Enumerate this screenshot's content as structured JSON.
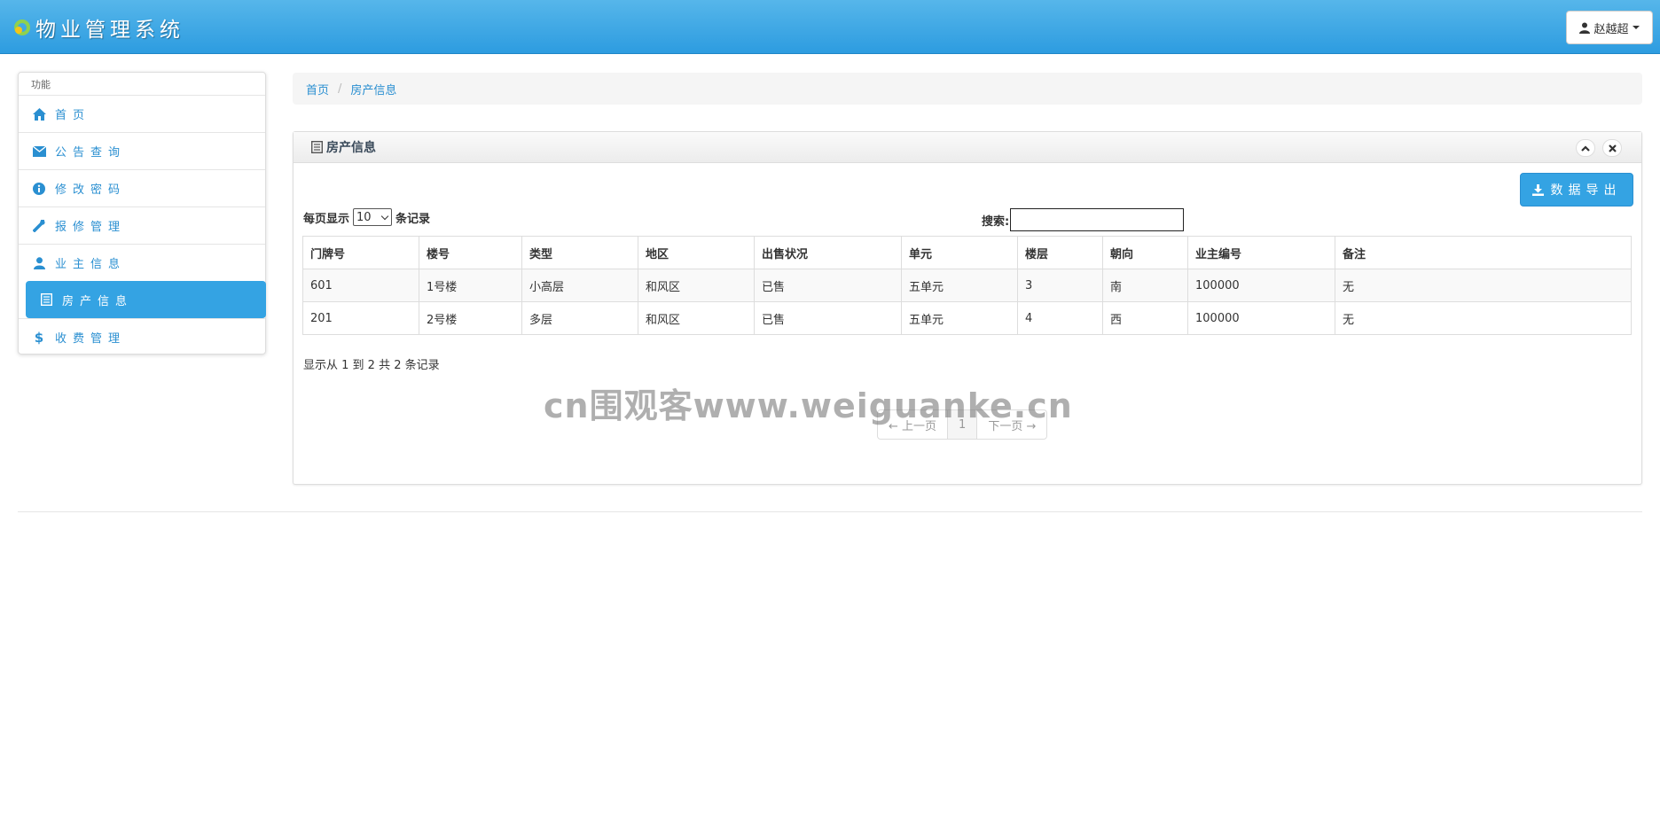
{
  "app": {
    "title": "物业管理系统",
    "user_name": "赵越超"
  },
  "sidebar": {
    "header": "功能",
    "items": [
      {
        "label": "首页",
        "icon": "home-icon"
      },
      {
        "label": "公告查询",
        "icon": "envelope-icon"
      },
      {
        "label": "修改密码",
        "icon": "info-icon"
      },
      {
        "label": "报修管理",
        "icon": "wrench-icon"
      },
      {
        "label": "业主信息",
        "icon": "user-icon"
      },
      {
        "label": "房产信息",
        "icon": "list-icon",
        "active": true
      },
      {
        "label": "收费管理",
        "icon": "dollar-icon"
      }
    ]
  },
  "breadcrumb": {
    "home": "首页",
    "current": "房产信息"
  },
  "panel": {
    "title": "房产信息",
    "export_label": "数据导出",
    "length_prefix": "每页显示",
    "length_value": "10",
    "length_suffix": "条记录",
    "search_label": "搜索:",
    "search_value": ""
  },
  "table": {
    "columns": [
      "门牌号",
      "楼号",
      "类型",
      "地区",
      "出售状况",
      "单元",
      "楼层",
      "朝向",
      "业主编号",
      "备注"
    ],
    "rows": [
      [
        "601",
        "1号楼",
        "小高层",
        "和风区",
        "已售",
        "五单元",
        "3",
        "南",
        "100000",
        "无"
      ],
      [
        "201",
        "2号楼",
        "多层",
        "和风区",
        "已售",
        "五单元",
        "4",
        "西",
        "100000",
        "无"
      ]
    ]
  },
  "info_text": "显示从 1 到 2 共 2 条记录",
  "pager": {
    "prev": "← 上一页",
    "current": "1",
    "next": "下一页 →"
  },
  "watermark": "cn围观客www.weiguanke.cn",
  "colors": {
    "header_blue": "#2d9ce0",
    "accent": "#34a3e3",
    "link": "#2a8fd1"
  }
}
